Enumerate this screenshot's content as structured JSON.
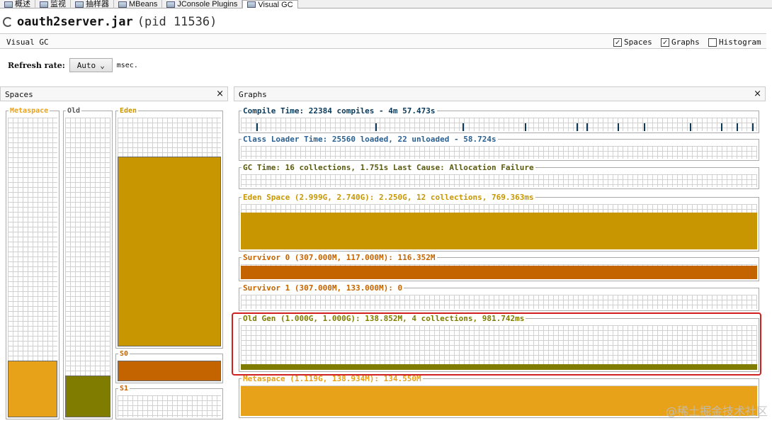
{
  "tabs": [
    {
      "label": "概述",
      "icon": "overview-icon"
    },
    {
      "label": "监视",
      "icon": "monitor-icon"
    },
    {
      "label": "抽样器",
      "icon": "sampler-icon"
    },
    {
      "label": "MBeans",
      "icon": "mbeans-icon"
    },
    {
      "label": "JConsole Plugins",
      "icon": "plugin-icon"
    },
    {
      "label": "Visual GC",
      "icon": "visualgc-icon"
    }
  ],
  "app": {
    "name": "oauth2server.jar",
    "pid": "(pid 11536)"
  },
  "visualgc": {
    "title": "Visual GC",
    "checkboxes": [
      {
        "label": "Spaces",
        "checked": "✓"
      },
      {
        "label": "Graphs",
        "checked": "✓"
      },
      {
        "label": "Histogram",
        "checked": ""
      }
    ]
  },
  "refresh": {
    "label": "Refresh rate:",
    "value": "Auto",
    "unit": "msec.",
    "arrow": "⌄"
  },
  "spaces_panel": {
    "title": "Spaces",
    "close": "×",
    "metaspace": {
      "label": "Metaspace",
      "level": 0.19,
      "color": "#e7a21a"
    },
    "old": {
      "label": "Old",
      "level": 0.14,
      "color": "#7f7c00"
    },
    "eden": {
      "label": "Eden",
      "level": 0.83,
      "color": "#c79600"
    },
    "s0": {
      "label": "S0",
      "level": 1.0,
      "color": "#c46400"
    },
    "s1": {
      "label": "S1",
      "level": 0.0,
      "color": "#c46400"
    }
  },
  "graphs_panel": {
    "title": "Graphs",
    "close": "×",
    "graphs": [
      {
        "label": "Compile Time: 22384 compiles - 4m 57.473s",
        "color": "#0a3a5a"
      },
      {
        "label": "Class Loader Time: 25560 loaded, 22 unloaded - 58.724s",
        "color": "#2a6090"
      },
      {
        "label": "GC Time: 16 collections, 1.751s  Last Cause: Allocation Failure",
        "color": "#5a5a10"
      },
      {
        "label": "Eden Space (2.999G, 2.740G): 2.250G, 12 collections, 769.363ms",
        "color": "#c79600",
        "level": 0.82
      },
      {
        "label": "Survivor 0 (307.000M, 117.000M): 116.352M",
        "color": "#c46400",
        "level": 0.9
      },
      {
        "label": "Survivor 1 (307.000M, 133.000M): 0",
        "color": "#c46400",
        "level": 0.0
      },
      {
        "label": "Old Gen (1.000G, 1.000G): 138.852M, 4 collections, 981.742ms",
        "color": "#7f7c00",
        "level": 0.12
      },
      {
        "label": "Metaspace (1.119G, 138.934M): 134.550M",
        "color": "#e7a21a",
        "level": 0.97
      }
    ]
  },
  "watermark": "@稀土掘金技术社区"
}
